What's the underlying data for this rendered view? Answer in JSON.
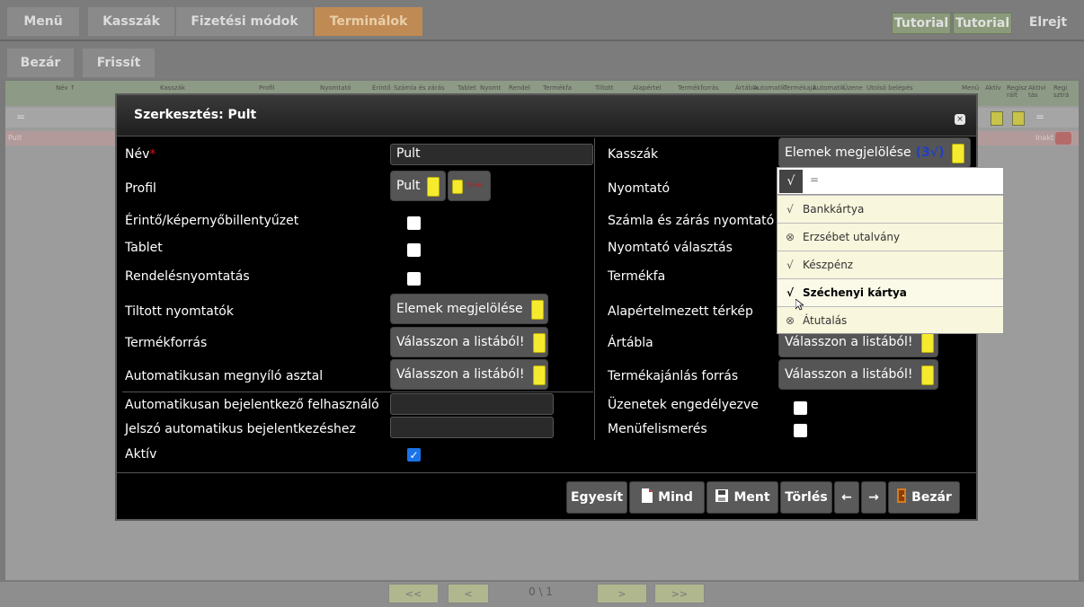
{
  "topbar": {
    "menu": "Menü",
    "kasszak": "Kasszák",
    "fizetesi": "Fizetési módok",
    "terminalok": "Terminálok",
    "tutorial1": "Tutorial",
    "tutorial2": "Tutorial",
    "elrejt": "Elrejt"
  },
  "toolbar": {
    "bezar": "Bezár",
    "frissit": "Frissít"
  },
  "grid": {
    "headers": [
      "Név ↑",
      "Kasszák",
      "Profil",
      "Nyomtató",
      "Érintő",
      "Számla és zárás",
      "Tablet",
      "Nyomt",
      "Rendel",
      "Termékfa",
      "Tiltott",
      "Alapértel",
      "Termékforrás",
      "Ártábla",
      "Automatik",
      "Termékajá",
      "Automatik",
      "Üzene",
      "Utolsó belépés",
      "Menü",
      "Aktív",
      "Regisz rált",
      "Aktivi tás",
      "Regi sztrá"
    ],
    "filter_symbol": "=",
    "row_name": "Pult",
    "row_status": "Inakt"
  },
  "pager": {
    "first": "<<",
    "prev": "<",
    "info": "0 \\ 1",
    "next": ">",
    "last": ">>"
  },
  "modal": {
    "title": "Szerkesztés: Pult",
    "close": "×",
    "left": {
      "nev_label": "Név",
      "nev_required": "*",
      "nev_value": "Pult",
      "profil_label": "Profil",
      "profil_value": "Pult",
      "profil_torles": "Törlés",
      "erinto_label": "Érintő/képernyőbillentyűzet",
      "tablet_label": "Tablet",
      "rendeles_label": "Rendelésnyomtatás",
      "tiltott_label": "Tiltott nyomtatók",
      "tiltott_btn": "Elemek megjelölése",
      "termekforras_label": "Termékforrás",
      "termekforras_btn": "Válasszon a listából!",
      "auto_asztal_label": "Automatikusan megnyíló asztal",
      "auto_asztal_btn": "Válasszon a listából!",
      "auto_user_label": "Automatikusan bejelentkező felhasználó",
      "jelszo_label": "Jelszó automatikus bejelentkezéshez",
      "aktiv_label": "Aktív",
      "aktiv_check": "✓"
    },
    "right": {
      "kasszak_label": "Kasszák",
      "kasszak_btn": "Elemek megjelölése",
      "kasszak_count": "(3√)",
      "nyomtato_label": "Nyomtató",
      "szamla_label": "Számla és zárás nyomtató",
      "valasztas_label": "Nyomtató választás",
      "termekfa_label": "Termékfa",
      "terkep_label": "Alapértelmezett térkép",
      "artabla_label": "Ártábla",
      "artabla_btn": "Válasszon a listából!",
      "ajanlas_label": "Termékajánlás forrás",
      "ajanlas_btn": "Válasszon a listából!",
      "uzenetek_label": "Üzenetek engedélyezve",
      "menufel_label": "Menüfelismerés"
    },
    "footer": {
      "egyesit": "Egyesít",
      "mind": "Mind",
      "ment": "Ment",
      "torles": "Törlés",
      "left_arrow": "←",
      "right_arrow": "→",
      "bezar": "Bezár"
    }
  },
  "dropdown": {
    "check_all": "√",
    "search": "=",
    "items": [
      {
        "mark": "√",
        "label": "Bankkártya"
      },
      {
        "mark": "⊗",
        "label": "Erzsébet utalvány"
      },
      {
        "mark": "√",
        "label": "Készpénz"
      },
      {
        "mark": "√",
        "label": "Széchenyi kártya"
      },
      {
        "mark": "⊗",
        "label": "Átutalás"
      }
    ]
  },
  "colors": {
    "accent_active_tab": "#c08a55",
    "required_star": "#d21414",
    "yellow_marker": "#f5ea2e",
    "count_blue": "#1f3fc9"
  }
}
